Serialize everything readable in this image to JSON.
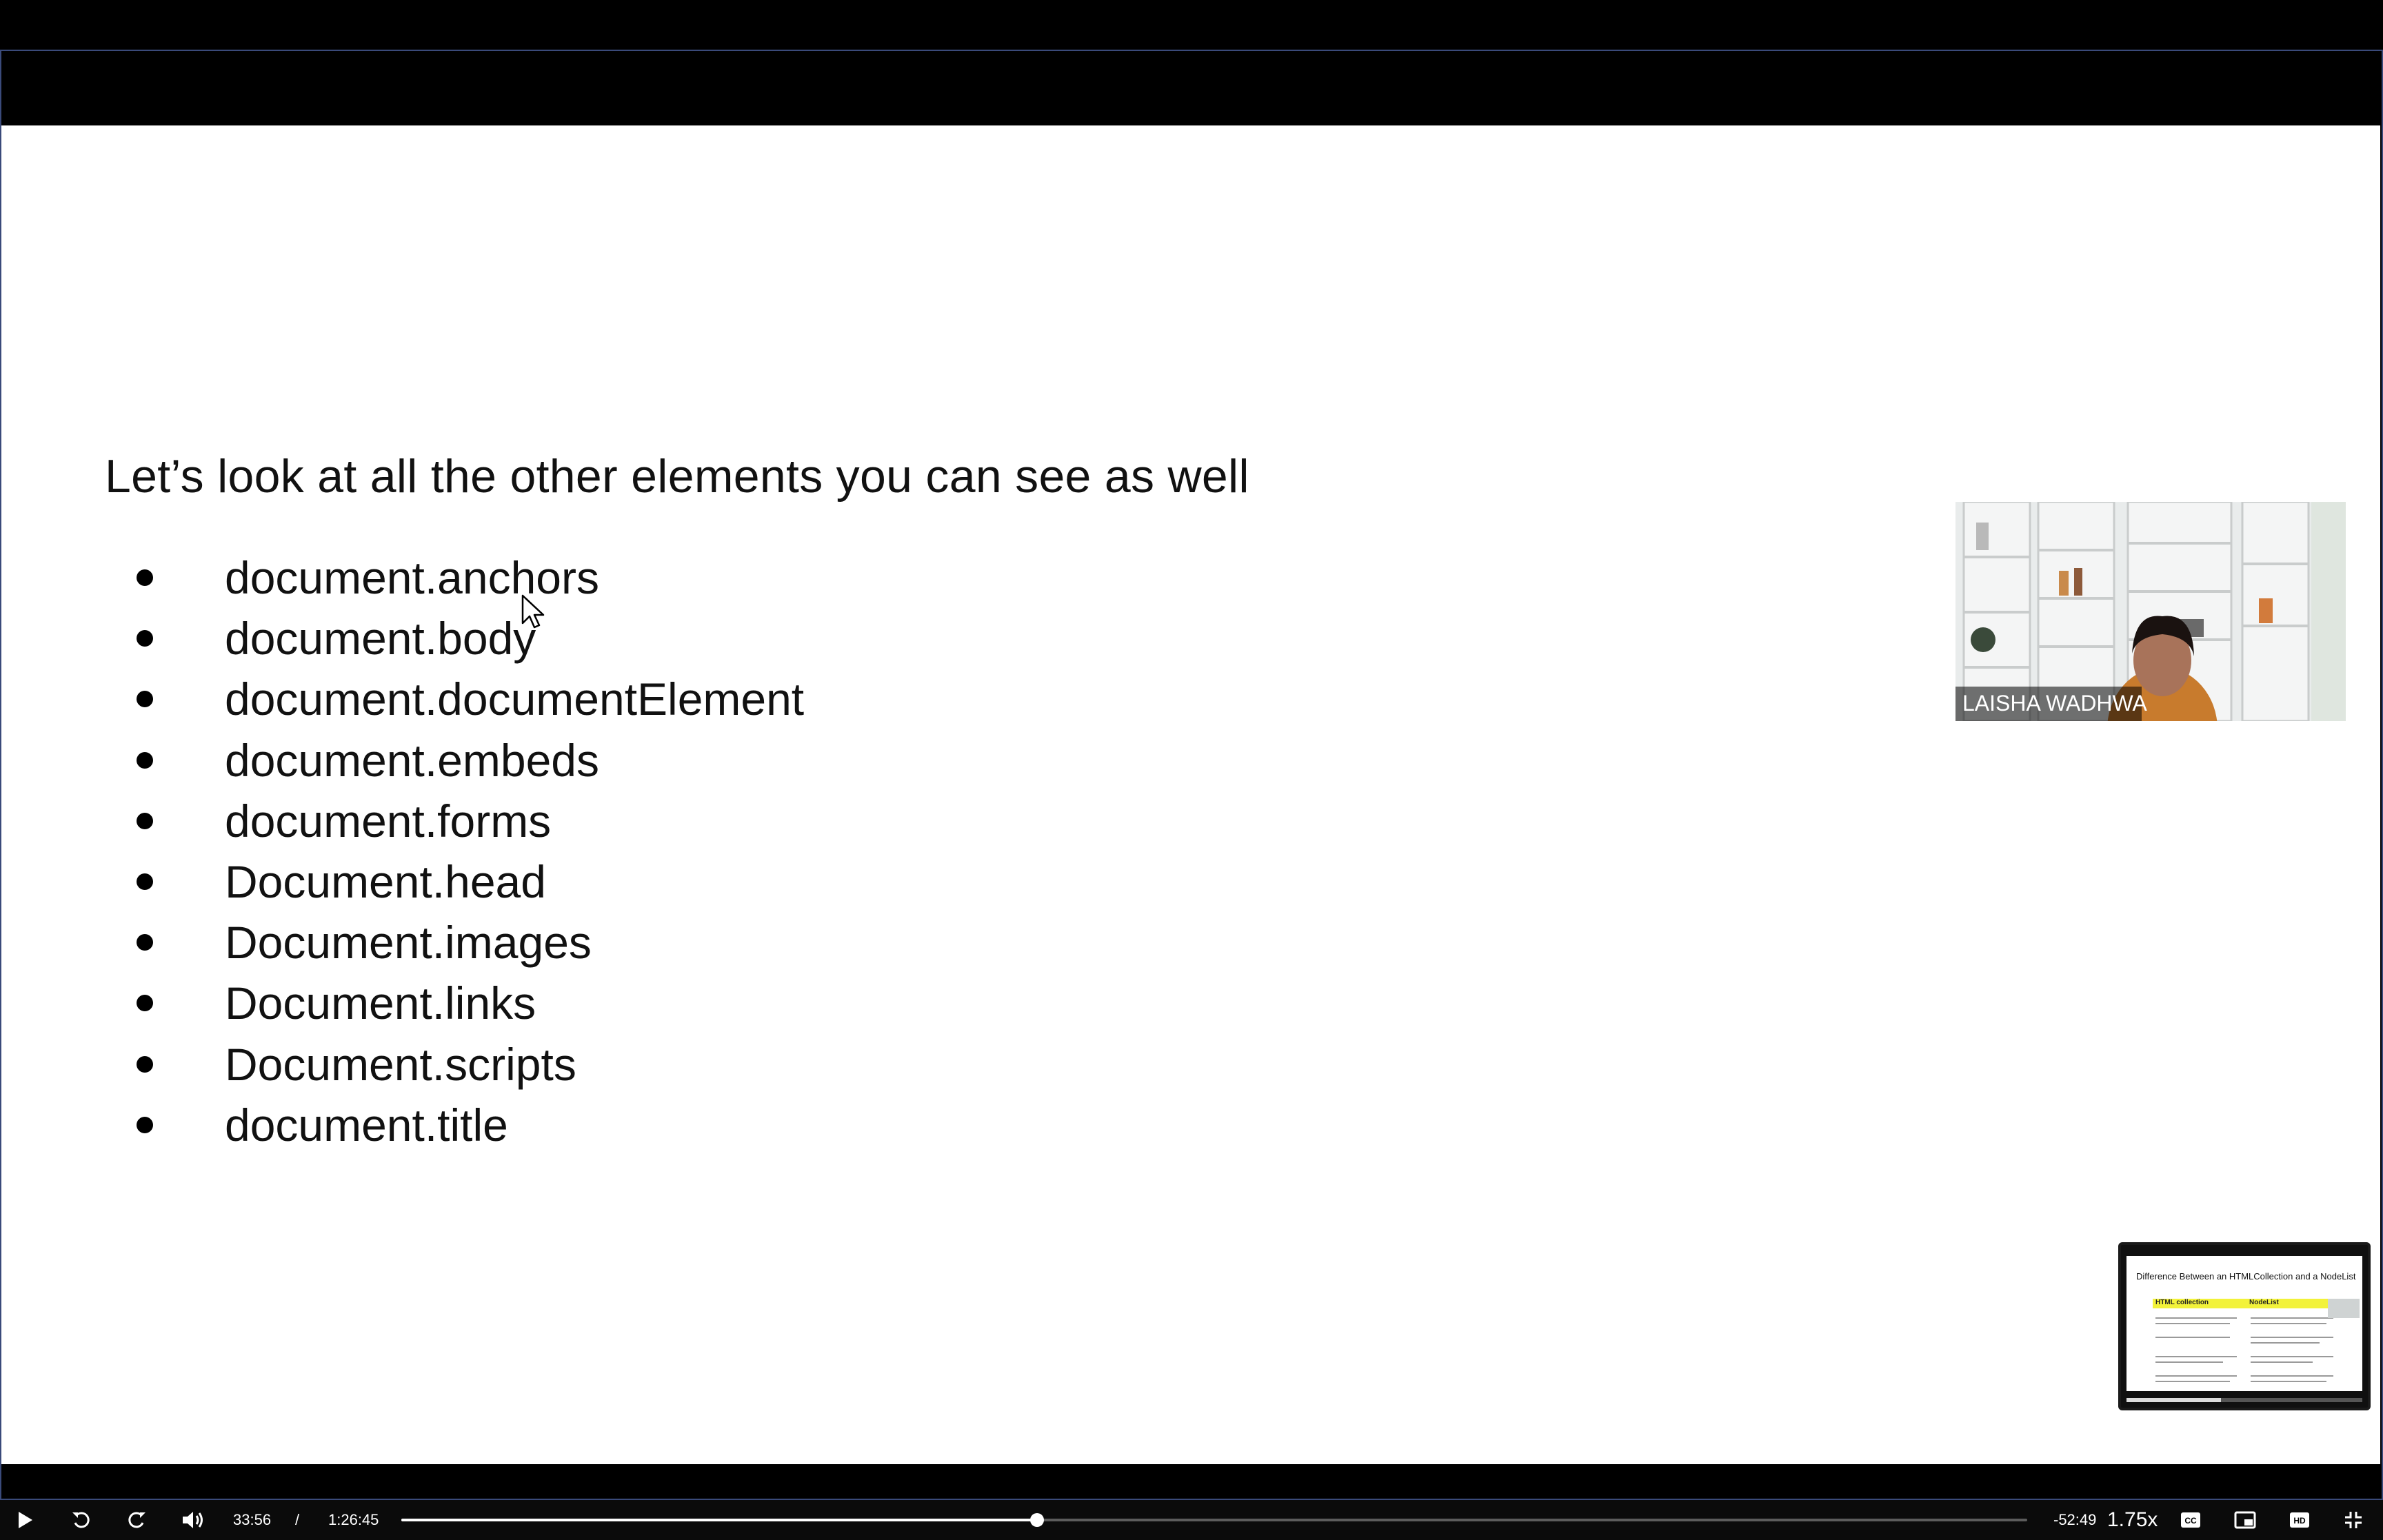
{
  "slide": {
    "heading": "Let’s look at all the other elements you can see as well",
    "items": [
      "document.anchors",
      "document.body",
      "document.documentElement",
      "document.embeds",
      "document.forms",
      "Document.head",
      "Document.images",
      "Document.links",
      "Document.scripts",
      "document.title"
    ]
  },
  "webcam": {
    "speaker_name": "LAISHA WADHWA"
  },
  "preview_thumbnail": {
    "title": "Difference Between an HTMLCollection and a NodeList",
    "columns": [
      "HTML collection",
      "NodeList"
    ]
  },
  "controls": {
    "current_time": "33:56",
    "separator": "/",
    "duration": "1:26:45",
    "remaining": "-52:49",
    "speed": "1.75x",
    "progress_fraction": 0.391,
    "icons": [
      "play-icon",
      "rewind-icon",
      "forward-icon",
      "volume-icon",
      "captions-icon",
      "picture-in-picture-icon",
      "hd-icon",
      "exit-fullscreen-icon"
    ]
  },
  "colors": {
    "slide_background": "#ffffff",
    "player_background": "#000000",
    "controls_background": "#0b0b0b",
    "thumbnail_highlight": "#f2f23a"
  }
}
